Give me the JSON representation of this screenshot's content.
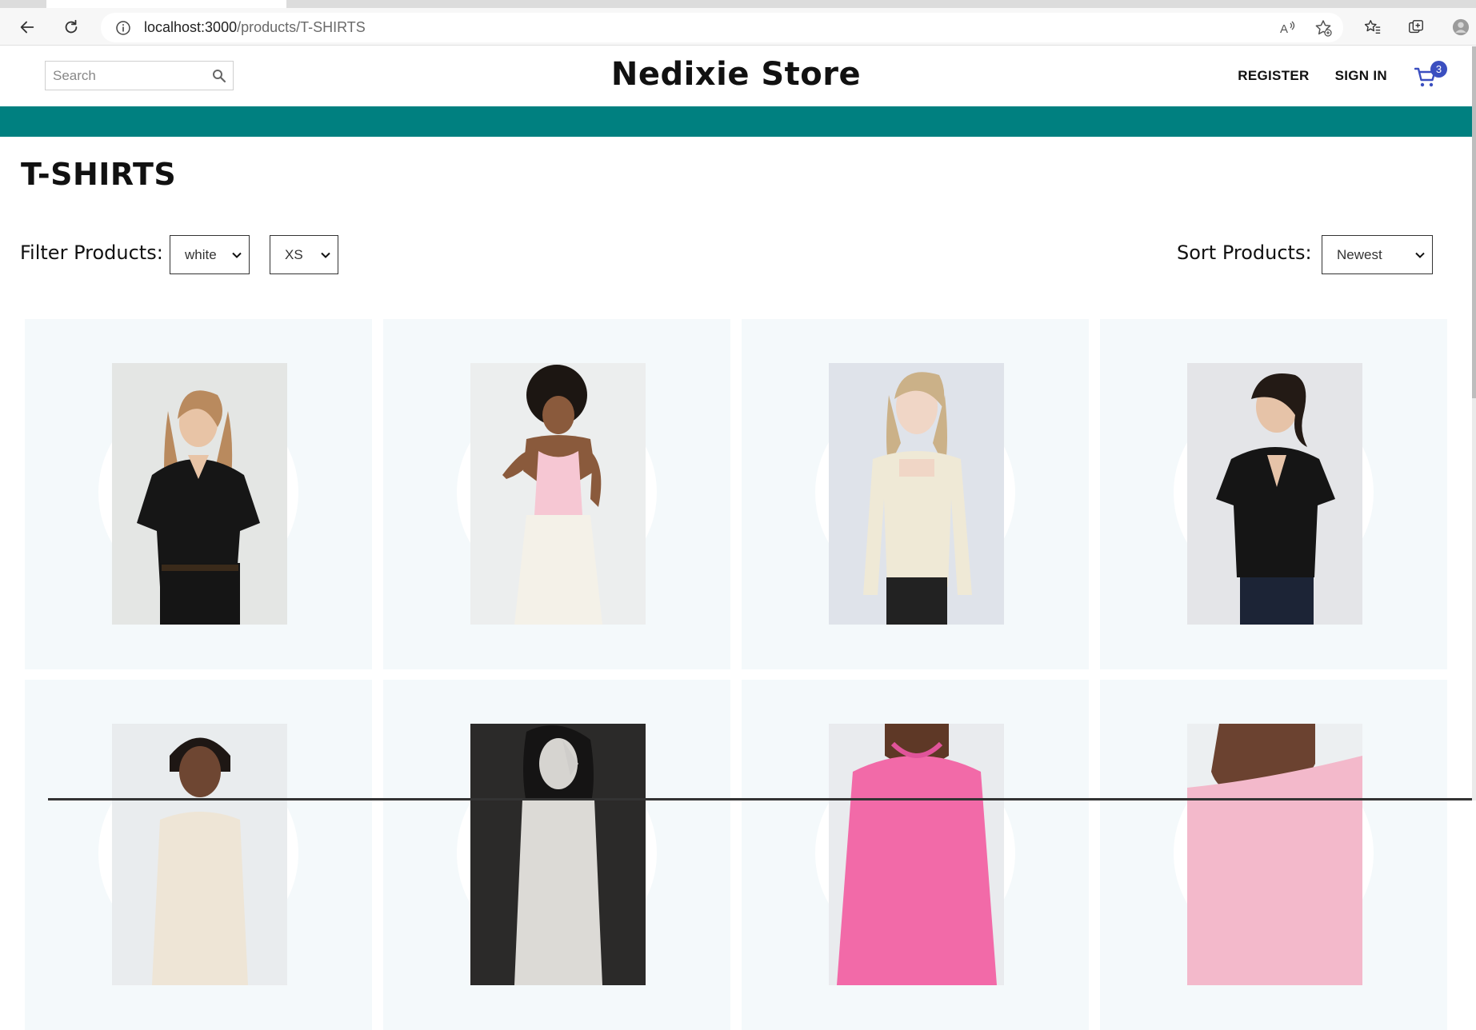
{
  "browser": {
    "url_host": "localhost:3000",
    "url_path": "/products/T-SHIRTS",
    "icons": [
      "back-icon",
      "refresh-icon",
      "info-icon",
      "read-aloud-icon",
      "add-favorite-icon",
      "favorites-icon",
      "collections-icon",
      "profile-icon"
    ]
  },
  "header": {
    "search_placeholder": "Search",
    "brand": "Nedixie Store",
    "register_label": "REGISTER",
    "signin_label": "SIGN IN",
    "cart_count": "3"
  },
  "colors": {
    "accent_bar": "#008080",
    "badge": "#3b4fc0",
    "card_bg": "#f4f9fb"
  },
  "page": {
    "title": "T-SHIRTS",
    "filter_label": "Filter Products:",
    "filter_color_value": "white",
    "filter_size_value": "XS",
    "sort_label": "Sort Products:",
    "sort_value": "Newest"
  },
  "products": [
    {
      "image": "model-black-vneck-tshirt"
    },
    {
      "image": "model-pink-tank-top"
    },
    {
      "image": "model-cream-longsleeve-top"
    },
    {
      "image": "model-black-twist-tshirt"
    },
    {
      "image": "model-braids-cream-top"
    },
    {
      "image": "model-monochrome-portrait"
    },
    {
      "image": "model-pink-tshirt"
    },
    {
      "image": "model-pink-offshoulder-top"
    }
  ]
}
